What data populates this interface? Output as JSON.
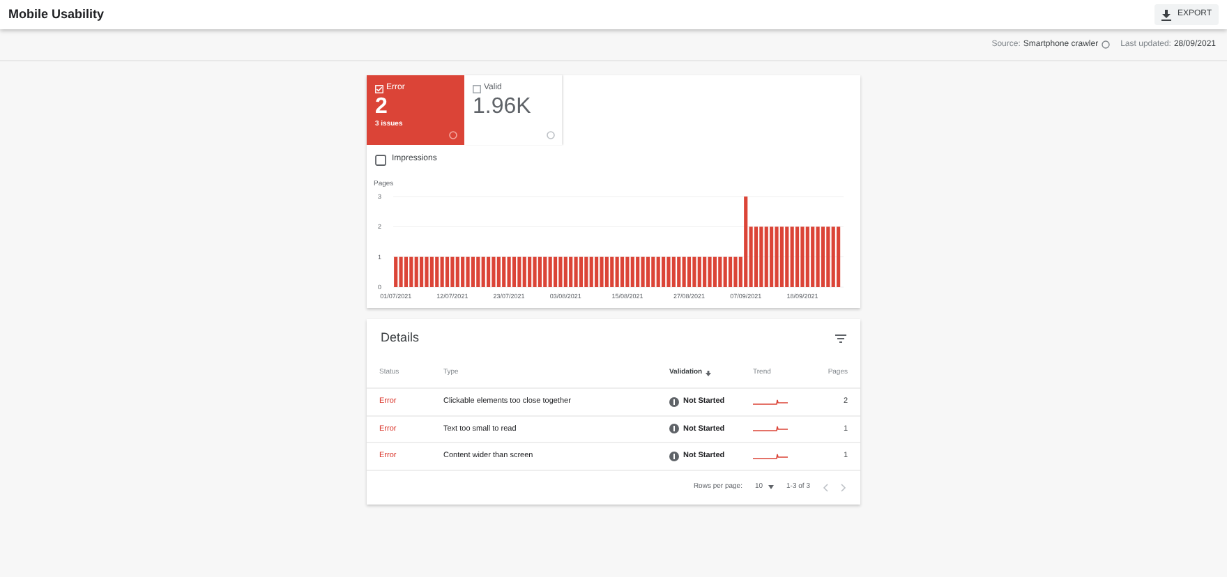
{
  "header": {
    "title": "Mobile Usability",
    "export_label": "EXPORT"
  },
  "meta": {
    "source_label": "Source:",
    "source_value": "Smartphone crawler",
    "updated_label": "Last updated:",
    "updated_value": "28/09/2021"
  },
  "tiles": [
    {
      "label": "Error",
      "value": "2",
      "sub": "3 issues",
      "checked": true,
      "kind": "error"
    },
    {
      "label": "Valid",
      "value": "1.96K",
      "checked": false,
      "kind": "valid"
    }
  ],
  "impressions": {
    "label": "Impressions",
    "checked": false
  },
  "chart_data": {
    "type": "bar",
    "ylabel": "Pages",
    "ylim": [
      0,
      3
    ],
    "yticks": [
      0,
      1,
      2,
      3
    ],
    "categories": [
      "01/07/2021",
      null,
      null,
      null,
      null,
      null,
      null,
      null,
      null,
      null,
      null,
      "12/07/2021",
      null,
      null,
      null,
      null,
      null,
      null,
      null,
      null,
      null,
      null,
      "23/07/2021",
      null,
      null,
      null,
      null,
      null,
      null,
      null,
      null,
      null,
      null,
      "03/08/2021",
      null,
      null,
      null,
      null,
      null,
      null,
      null,
      null,
      null,
      null,
      null,
      "15/08/2021",
      null,
      null,
      null,
      null,
      null,
      null,
      null,
      null,
      null,
      null,
      null,
      "27/08/2021",
      null,
      null,
      null,
      null,
      null,
      null,
      null,
      null,
      null,
      null,
      "07/09/2021",
      null,
      null,
      null,
      null,
      null,
      null,
      null,
      null,
      null,
      null,
      "18/09/2021",
      null,
      null,
      null,
      null,
      null,
      null,
      null
    ],
    "series": [
      {
        "color": "#db4437",
        "values": [
          1,
          1,
          1,
          1,
          1,
          1,
          1,
          1,
          1,
          1,
          1,
          1,
          1,
          1,
          1,
          1,
          1,
          1,
          1,
          1,
          1,
          1,
          1,
          1,
          1,
          1,
          1,
          1,
          1,
          1,
          1,
          1,
          1,
          1,
          1,
          1,
          1,
          1,
          1,
          1,
          1,
          1,
          1,
          1,
          1,
          1,
          1,
          1,
          1,
          1,
          1,
          1,
          1,
          1,
          1,
          1,
          1,
          1,
          1,
          1,
          1,
          1,
          1,
          1,
          1,
          1,
          1,
          1,
          3,
          2,
          2,
          2,
          2,
          2,
          2,
          2,
          2,
          2,
          2,
          2,
          2,
          2,
          2,
          2,
          2,
          2,
          2
        ]
      }
    ]
  },
  "details": {
    "title": "Details",
    "columns": [
      "Status",
      "Type",
      "Validation",
      "Trend",
      "Pages"
    ],
    "rows": [
      {
        "status": "Error",
        "type": "Clickable elements too close together",
        "validation": "Not Started",
        "pages": "2"
      },
      {
        "status": "Error",
        "type": "Text too small to read",
        "validation": "Not Started",
        "pages": "1"
      },
      {
        "status": "Error",
        "type": "Content wider than screen",
        "validation": "Not Started",
        "pages": "1"
      }
    ],
    "pagination": {
      "rows_label": "Rows per page:",
      "rows_value": "10",
      "range": "1-3 of 3"
    }
  }
}
